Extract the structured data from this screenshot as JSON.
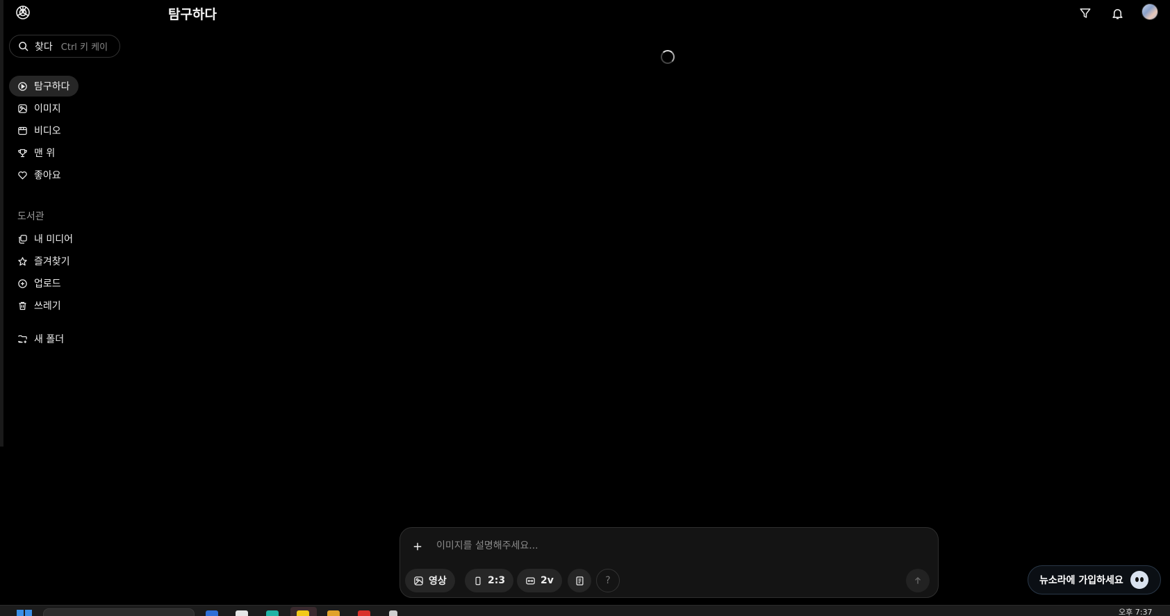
{
  "header": {
    "title": "탐구하다",
    "logo_icon": "openai-logo-icon",
    "icons": [
      "filter-icon",
      "bell-icon",
      "avatar"
    ]
  },
  "search": {
    "label": "찾다",
    "shortcut": "Ctrl 키 케이"
  },
  "sidebar": {
    "items": [
      {
        "label": "탐구하다",
        "icon": "compass-icon",
        "active": true
      },
      {
        "label": "이미지",
        "icon": "image-icon"
      },
      {
        "label": "비디오",
        "icon": "video-icon"
      },
      {
        "label": "맨 위",
        "icon": "trophy-icon"
      },
      {
        "label": "좋아요",
        "icon": "heart-icon"
      }
    ],
    "library": {
      "label": "도서관",
      "items": [
        {
          "label": "내 미디어",
          "icon": "media-icon"
        },
        {
          "label": "즐겨찾기",
          "icon": "star-icon"
        },
        {
          "label": "업로드",
          "icon": "upload-plus-icon"
        },
        {
          "label": "쓰레기",
          "icon": "trash-icon"
        }
      ]
    },
    "new_folder": {
      "label": "새 폴더",
      "icon": "folder-plus-icon"
    }
  },
  "composer": {
    "placeholder": "이미지를 설명해주세요...",
    "chips": {
      "type": "영상",
      "ratio": "2:3",
      "variations": "2v",
      "help": "?"
    }
  },
  "signup": {
    "label": "뉴소라에 가입하세요"
  },
  "taskbar": {
    "clock": "오후 7:37"
  },
  "colors": {
    "background": "#000000",
    "panel": "#141414",
    "chip": "#262626",
    "muted_text": "#8a8a8a"
  }
}
